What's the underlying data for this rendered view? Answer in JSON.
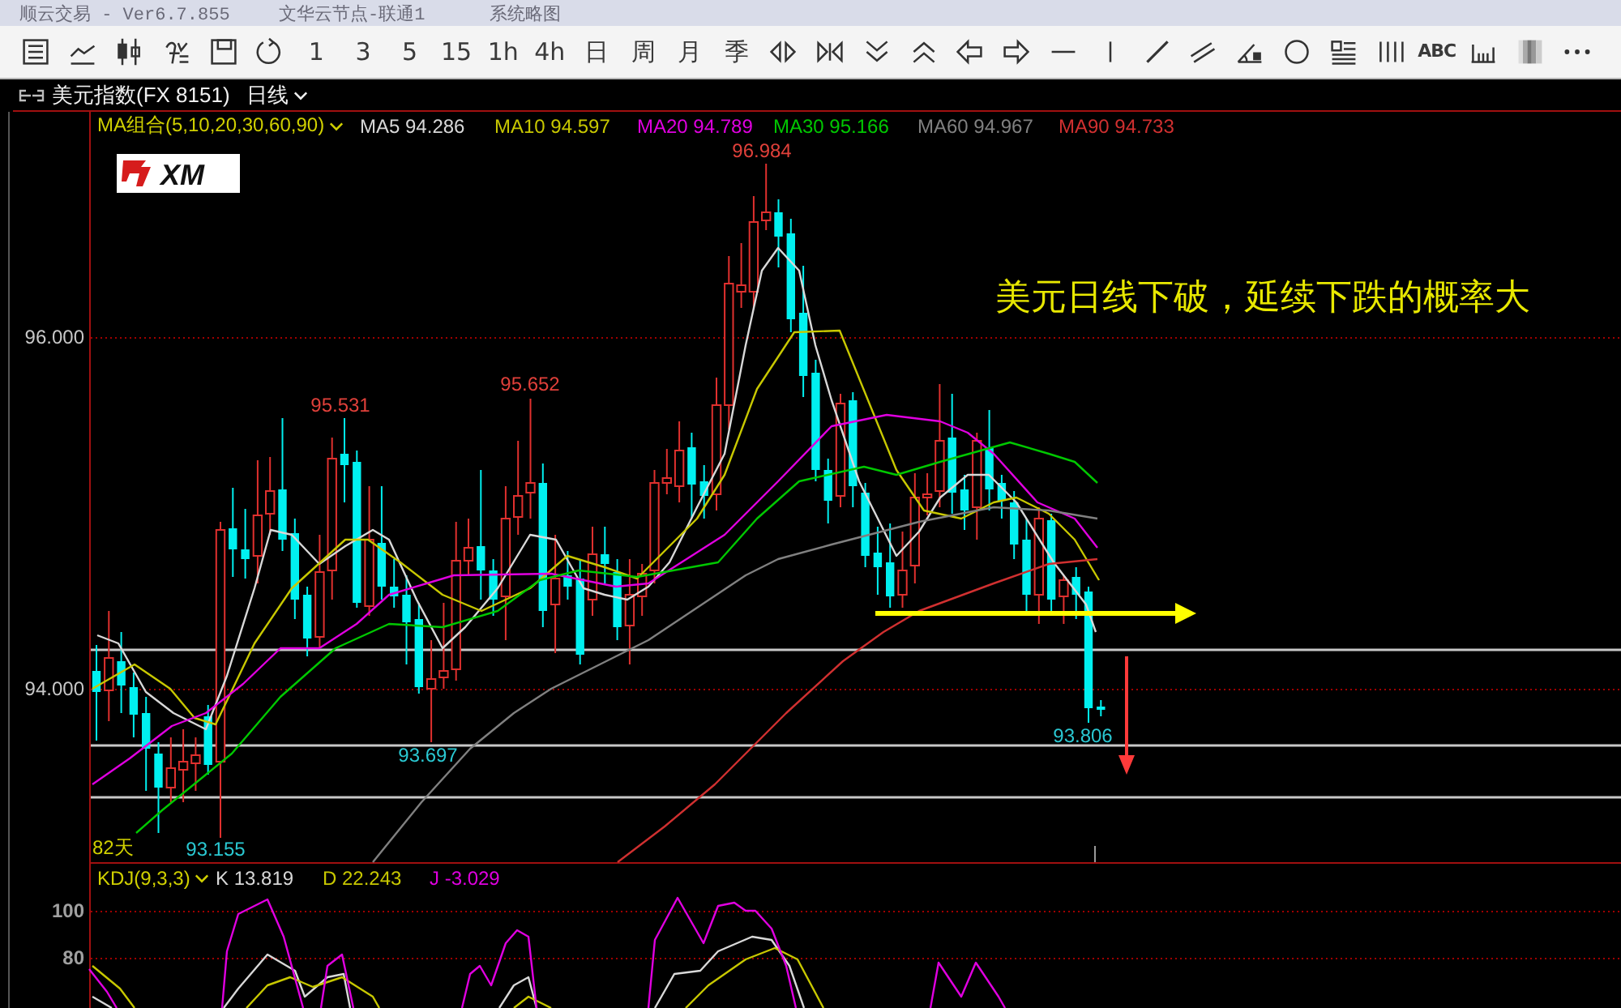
{
  "title_bar": {
    "app": "顺云交易  -  Ver6.7.855",
    "server": "文华云节点-联通1",
    "thumbnail": "系统略图"
  },
  "toolbar": {
    "periods": [
      "1",
      "3",
      "5",
      "15",
      "1h",
      "4h",
      "日",
      "周",
      "月",
      "季"
    ],
    "text_tool": "ABC"
  },
  "symbol": {
    "name": "美元指数(FX 8151)",
    "period": "日线"
  },
  "main_chart": {
    "indicator": "MA组合(5,10,20,30,60,90)",
    "legend": [
      {
        "label": "MA5 94.286",
        "color": "#d8d8d8"
      },
      {
        "label": "MA10 94.597",
        "color": "#c8c800"
      },
      {
        "label": "MA20 94.789",
        "color": "#e000e0"
      },
      {
        "label": "MA30 95.166",
        "color": "#00c800"
      },
      {
        "label": "MA60 94.967",
        "color": "#808080"
      },
      {
        "label": "MA90 94.733",
        "color": "#d03030"
      }
    ],
    "logo": "XM",
    "y_ticks": [
      "96.000",
      "94.000"
    ],
    "price_labels": [
      {
        "text": "96.984",
        "kind": "high"
      },
      {
        "text": "95.531",
        "kind": "high"
      },
      {
        "text": "95.652",
        "kind": "high"
      },
      {
        "text": "93.697",
        "kind": "low"
      },
      {
        "text": "93.155",
        "kind": "low"
      },
      {
        "text": "93.806",
        "kind": "low"
      }
    ],
    "bar_count": "82天",
    "note": "美元日线下破，延续下跌的概率大"
  },
  "kdj": {
    "indicator": "KDJ(9,3,3)",
    "legend": [
      {
        "label": "K 13.819",
        "color": "#d8d8d8"
      },
      {
        "label": "D 22.243",
        "color": "#c8c800"
      },
      {
        "label": "J -3.029",
        "color": "#e000e0"
      }
    ],
    "y_ticks": [
      "100",
      "80"
    ]
  }
}
